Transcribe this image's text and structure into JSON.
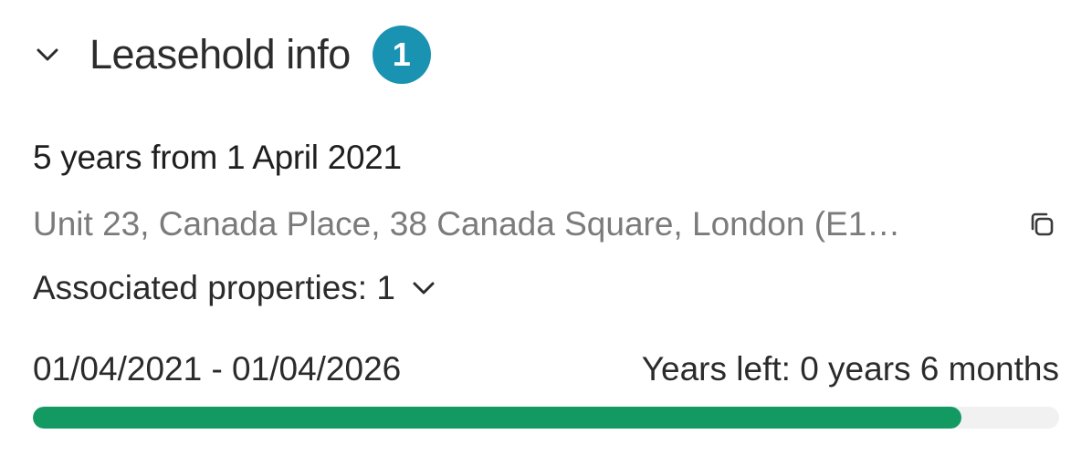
{
  "section": {
    "title": "Leasehold info",
    "badge_count": "1",
    "badge_color": "#1a93b2"
  },
  "lease": {
    "term": "5 years from 1 April 2021",
    "address": "Unit 23, Canada Place, 38 Canada Square, London (E1…",
    "associated_label": "Associated properties: 1",
    "date_range": "01/04/2021 - 01/04/2026",
    "years_left": "Years left: 0 years 6 months",
    "progress_fraction": 0.905,
    "progress_color": "#139a63"
  },
  "icons": {
    "section_toggle": "chevron-down-icon",
    "copy": "copy-icon",
    "associated_toggle": "chevron-down-icon"
  }
}
